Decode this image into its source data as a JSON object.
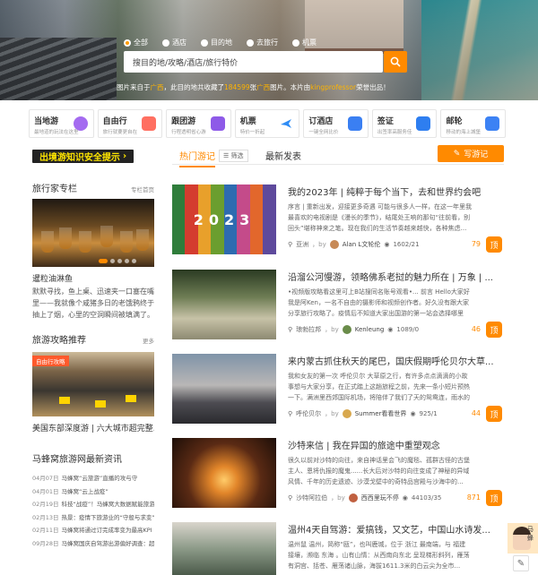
{
  "hero": {
    "radios": [
      {
        "label": "全部",
        "checked": true
      },
      {
        "label": "酒店",
        "checked": false
      },
      {
        "label": "目的地",
        "checked": false
      },
      {
        "label": "去旅行",
        "checked": false
      },
      {
        "label": "机票",
        "checked": false
      }
    ],
    "search_placeholder": "搜目的地/攻略/酒店/旅行特价",
    "credit_prefix": "图片来自于",
    "credit_loc1": "广西",
    "credit_mid1": "，此目的地共收藏了",
    "credit_count": "184599",
    "credit_mid2": "张",
    "credit_loc2": "广西",
    "credit_mid3": "图片。本片由",
    "credit_user": "kingprofessor",
    "credit_suffix": "荣誉出品！"
  },
  "categories": [
    {
      "title": "当地游",
      "sub": "最地道的玩法在这里",
      "color": "#a46bf0"
    },
    {
      "title": "自由行",
      "sub": "旅行就要更自在",
      "color": "#ff6f61"
    },
    {
      "title": "跟团游",
      "sub": "行程透明省心游",
      "color": "#8e5ae8"
    },
    {
      "title": "机票",
      "sub": "特价一折起",
      "color": "#2f8cf5"
    },
    {
      "title": "订酒店",
      "sub": "一键全网比价",
      "color": "#3a7ff2"
    },
    {
      "title": "签证",
      "sub": "出签率高服务佳",
      "color": "#2e7ef0"
    },
    {
      "title": "邮轮",
      "sub": "移动的海上城堡",
      "color": "#3c82f4"
    }
  ],
  "banner": {
    "text": "出境游知识安全提示"
  },
  "tabs": {
    "hot": "热门游记",
    "filter": "筛选",
    "latest": "最新发表",
    "write": "写游记"
  },
  "sidebar": {
    "column_title": "旅行家专栏",
    "column_more": "专栏首页",
    "column_item_title": "暹粒油淋鱼",
    "column_item_desc": "默默寻找，鱼上桌、迅速夹一口塞在嘴里——我就像个咸猪多日的老饿鸦终于抽上了烟，心里的空洞瞬间被填满了。",
    "guide_title": "旅游攻略推荐",
    "guide_more": "更多",
    "guide_tag": "自由行攻略",
    "guide_item_title": "美国东部深度游 | 六大城市超完整...",
    "news_title": "马蜂窝旅游网最新资讯",
    "news": [
      {
        "date": "04月07日",
        "text": "马蜂窝“云旅游”直播的攻与守"
      },
      {
        "date": "04月01日",
        "text": "马蜂窝“云上战疫”"
      },
      {
        "date": "02月19日",
        "text": "科技“战疫”！马蜂窝大数据赋能旅游业"
      },
      {
        "date": "02月13日",
        "text": "热景：疫情下旅游业的“守般与求变”"
      },
      {
        "date": "02月11日",
        "text": "马蜂窝将通过订完成率变为最高KPI"
      },
      {
        "date": "09月28日",
        "text": "马蜂窝国庆自驾游出游偏好调查：超70..."
      }
    ]
  },
  "posts": [
    {
      "title": "我的2023年 | 纯粹于每个当下，去和世界约会吧",
      "desc": "序言 | 重新出发，迎接更多奇遇 可能与很多人一样，在这一年里我最喜欢的电视剧是《漫长的季节》，结尾处王响的那句“往前看，别回头”堪称神来之笔。现在我们的生活节奏越来越快，各种焦虑...",
      "location": "亚洲",
      "author": "Alan L文轮伦",
      "views": "1602/21",
      "likes": "79",
      "ding": "顶",
      "overlay": "2023"
    },
    {
      "title": "沿溜公河慢游，领略佛系老挝的魅力所在 | 万象 | ...",
      "desc": "•视频版攻略看这里可上B站搜同名账号观看•... 前言 Hello大家好我是阿Ken，一名不自由的摄影师和视频创作者。好久没有跟大家分享旅行攻略了。疫情后不知道大家出国游的第一站会选择哪里呢...",
      "location": "琅勃拉邦",
      "author": "Kenleung",
      "views": "1089/0",
      "likes": "46",
      "ding": "顶"
    },
    {
      "title": "来内蒙古抓住秋天的尾巴，国庆假期呼伦贝尔大草...",
      "desc": "我和女友的第一次 呼伦贝尔 大草原之行，有许多点点滴滴的小故事想与大家分享，在正式踏上这趟旅程之前，先来一条小短片预热一下。满洲里西郊国际机场，将陪伴了我们了天的鸳鸯连，雨水的行程也...",
      "location": "呼伦贝尔",
      "author": "Summer看看世界",
      "views": "925/1",
      "likes": "44",
      "ding": "顶"
    },
    {
      "title": "沙特来信 | 我在异国的旅途中重塑观念",
      "desc": "很久以前对沙特的向往，来自神话里会飞的魔毯、孤群古怪的古堡主人、恩将仇报的魔鬼......长大后对沙特的向往变成了神秘的异域风情、千年的历史遗迹、沙漠戈壁中的奇特品宫殿与沙海中的...",
      "location": "沙特阿拉伯",
      "author": "西西里玩不停",
      "views": "44103/35",
      "likes": "871",
      "ding": "顶"
    },
    {
      "title": "温州4天自驾游：爱搞钱，又文艺，中国山水诗发...",
      "desc": "温州鼠 温州，简称“瓯”，也叫鹿城，位于 浙江 最南端，与 福建 接壤，濒临 东海 。山有山情：从西南向东北 呈现梯形斜列，雁荡有洞宫、括苍、雁荡诸山脉，海拔1611.3米的白云尖为全市...",
      "location": "",
      "author": "",
      "views": "",
      "likes": "",
      "ding": ""
    }
  ],
  "helper": {
    "label": "马蜂"
  }
}
